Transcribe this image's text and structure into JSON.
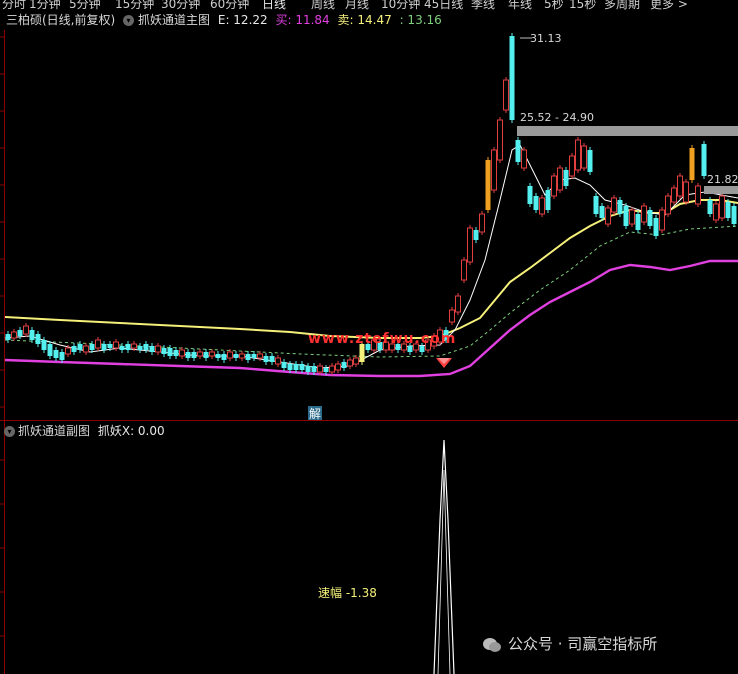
{
  "toolbar": {
    "tabs": [
      "分时",
      "1分钟",
      "5分钟",
      "15分钟",
      "30分钟",
      "60分钟",
      "日线",
      "周线",
      "月线",
      "10分钟",
      "45日线",
      "季线",
      "年线",
      "5秒",
      "15秒",
      "多周期",
      "更多 >"
    ],
    "active_tab": "日线"
  },
  "main_title": {
    "stock": "三柏硕(日线,前复权)",
    "indicator": "抓妖通道主图",
    "e_label": "E: 12.22",
    "buy_label": "买: 11.84",
    "sell_label": "卖: 14.47",
    "extra_value": ": 13.16"
  },
  "annotations": {
    "high_price": "31.13",
    "resistance_range": "25.52 - 24.90",
    "right_level": "21.82",
    "watermark_text": "www.ztefwu.com",
    "jie_marker": "解"
  },
  "sub_title": {
    "indicator": "抓妖通道副图",
    "value_label": "抓妖X: 0.00"
  },
  "sub_chart": {
    "speed_label": "速幅 -1.38"
  },
  "watermark": {
    "text": "公众号 · 司赢空指标所"
  },
  "colors": {
    "up": "#e04040",
    "down": "#54f0f0",
    "yellow_line": "#f5f07a",
    "magenta_line": "#e040e0",
    "gold_bar": "#f0a020",
    "grid": "#8b0000"
  }
}
